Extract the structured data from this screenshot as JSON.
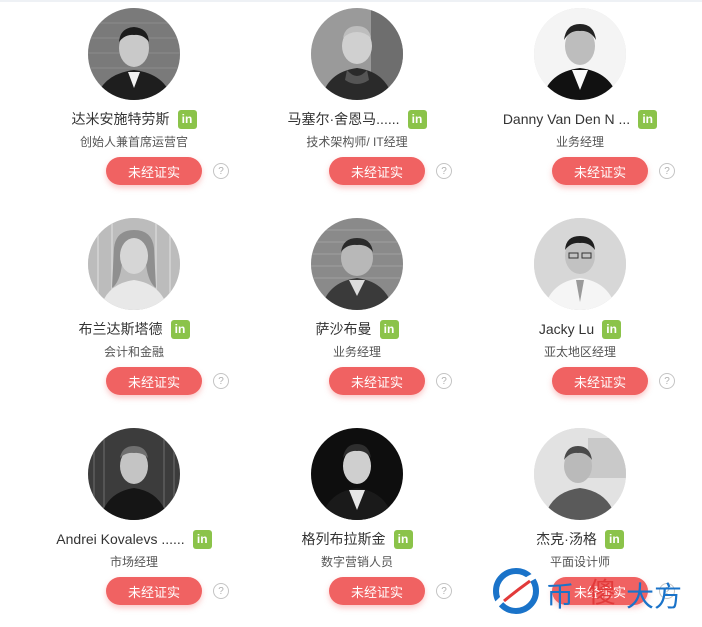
{
  "people": [
    {
      "name": "达米安施特劳斯",
      "role": "创始人兼首席运营官",
      "linkedin": "in",
      "status": "未经证实",
      "help": "?"
    },
    {
      "name": "马塞尔·舍恩马......",
      "role": "技术架构师/ IT经理",
      "linkedin": "in",
      "status": "未经证实",
      "help": "?"
    },
    {
      "name": "Danny Van Den N ...",
      "role": "业务经理",
      "linkedin": "in",
      "status": "未经证实",
      "help": "?"
    },
    {
      "name": "布兰达斯塔德",
      "role": "会计和金融",
      "linkedin": "in",
      "status": "未经证实",
      "help": "?"
    },
    {
      "name": "萨沙布曼",
      "role": "业务经理",
      "linkedin": "in",
      "status": "未经证实",
      "help": "?"
    },
    {
      "name": "Jacky Lu",
      "role": "亚太地区经理",
      "linkedin": "in",
      "status": "未经证实",
      "help": "?"
    },
    {
      "name": "Andrei Kovalevs ......",
      "role": "市场经理",
      "linkedin": "in",
      "status": "未经证实",
      "help": "?"
    },
    {
      "name": "格列布拉斯金",
      "role": "数字营销人员",
      "linkedin": "in",
      "status": "未经证实",
      "help": "?"
    },
    {
      "name": "杰克·汤格",
      "role": "平面设计师",
      "linkedin": "in",
      "status": "未经证实",
      "help": "?"
    }
  ],
  "watermark": {
    "part1": "币",
    "part2": "傻",
    "part3": "大方"
  },
  "colors": {
    "button": "#f06262",
    "linkedin": "#8bc34a",
    "watermark_blue": "#1a73c9",
    "watermark_red": "#e23a3a"
  }
}
